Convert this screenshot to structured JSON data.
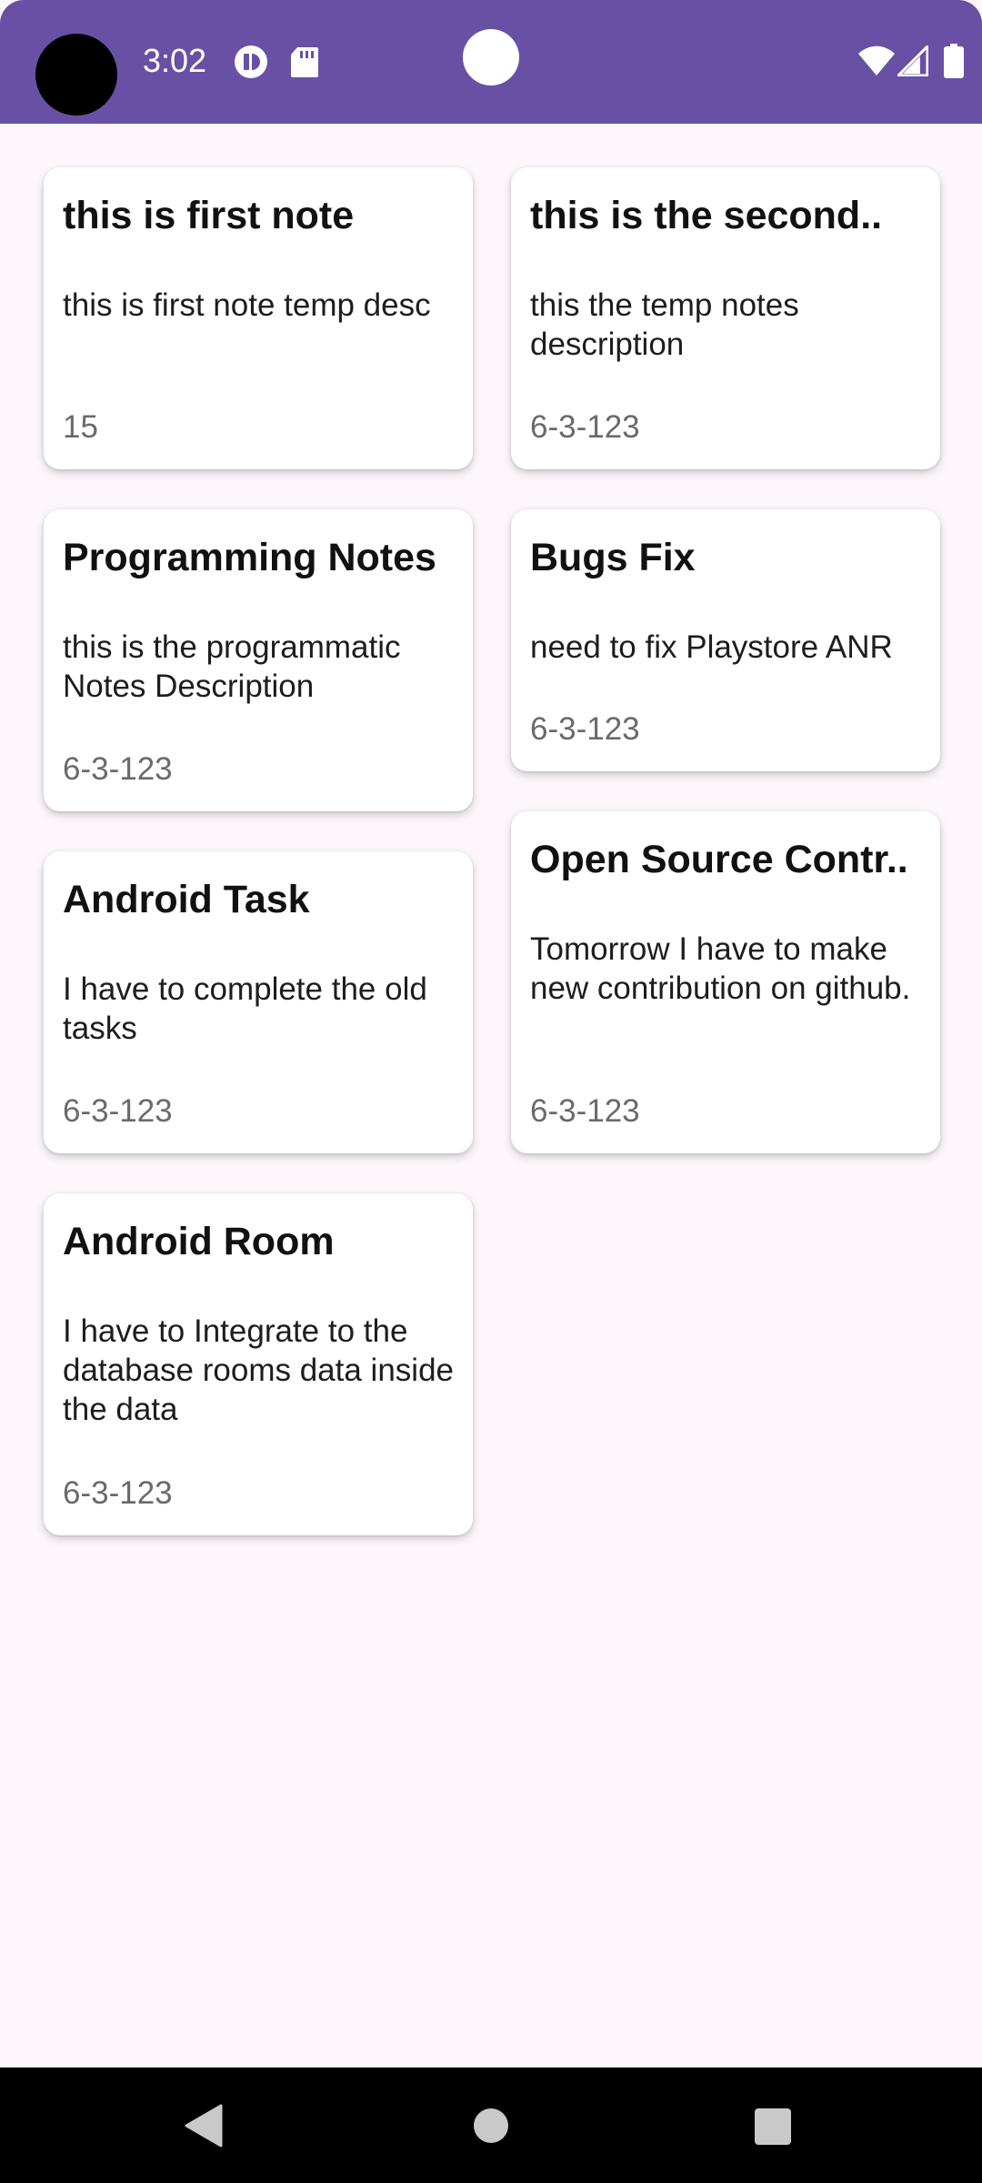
{
  "status_bar": {
    "time": "3:02",
    "background": "#6851a5",
    "icons": [
      "notification-icon",
      "sd-card-icon",
      "wifi-icon",
      "cell-signal-icon",
      "battery-icon"
    ]
  },
  "notes": [
    {
      "title": "this is first note",
      "description": "this is first note temp desc",
      "date": "15"
    },
    {
      "title": "this is the second..",
      "description": "this the temp notes description",
      "date": "6-3-123"
    },
    {
      "title": "Programming Notes",
      "description": "this is the programmatic Notes Description",
      "date": "6-3-123"
    },
    {
      "title": "Bugs Fix",
      "description": "need to fix Playstore ANR",
      "date": "6-3-123"
    },
    {
      "title": "Android Task",
      "description": "I have to complete the old tasks",
      "date": "6-3-123"
    },
    {
      "title": "Open Source Contr..",
      "description": "Tomorrow I have to make new contribution on github.",
      "date": "6-3-123"
    },
    {
      "title": "Android Room",
      "description": "I have to Integrate to the database rooms data inside the data",
      "date": "6-3-123"
    }
  ],
  "nav_bar": {
    "icons": [
      "back-icon",
      "home-icon",
      "recents-icon"
    ]
  }
}
